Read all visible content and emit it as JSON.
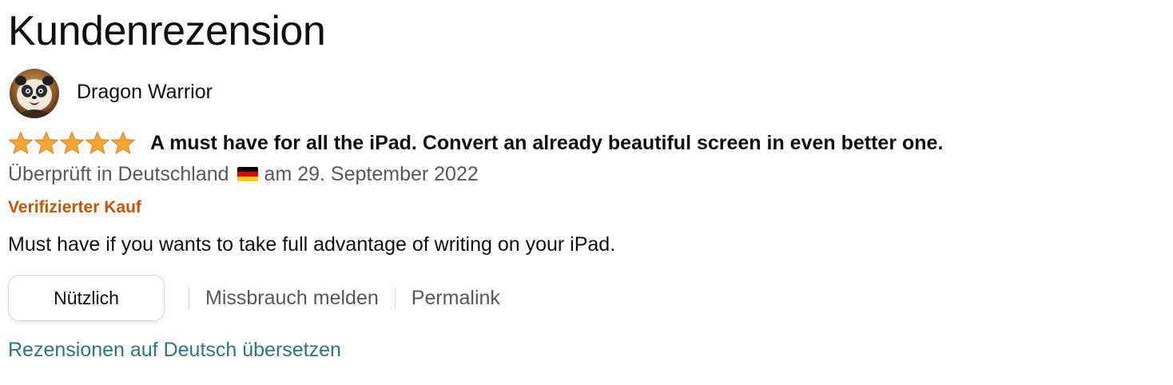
{
  "page": {
    "title": "Kundenrezension"
  },
  "review": {
    "author": "Dragon Warrior",
    "rating": 5,
    "rating_max": 5,
    "title": "A must have for all the iPad. Convert an already beautiful screen in even better one.",
    "meta_before_flag": "Überprüft in Deutschland",
    "meta_after_flag": "am 29. September 2022",
    "verified_label": "Verifizierter Kauf",
    "body": "Must have if you wants to take full advantage of writing on your iPad."
  },
  "actions": {
    "helpful_label": "Nützlich",
    "report_label": "Missbrauch melden",
    "permalink_label": "Permalink"
  },
  "translate": {
    "label": "Rezensionen auf Deutsch übersetzen"
  },
  "icons": {
    "avatar": "panda-avatar-icon",
    "star": "star-icon",
    "flag": "germany-flag-icon"
  },
  "colors": {
    "star": "#f8a434",
    "verified": "#c45500",
    "link": "#2c7581",
    "muted": "#565959",
    "text": "#0f1111"
  }
}
